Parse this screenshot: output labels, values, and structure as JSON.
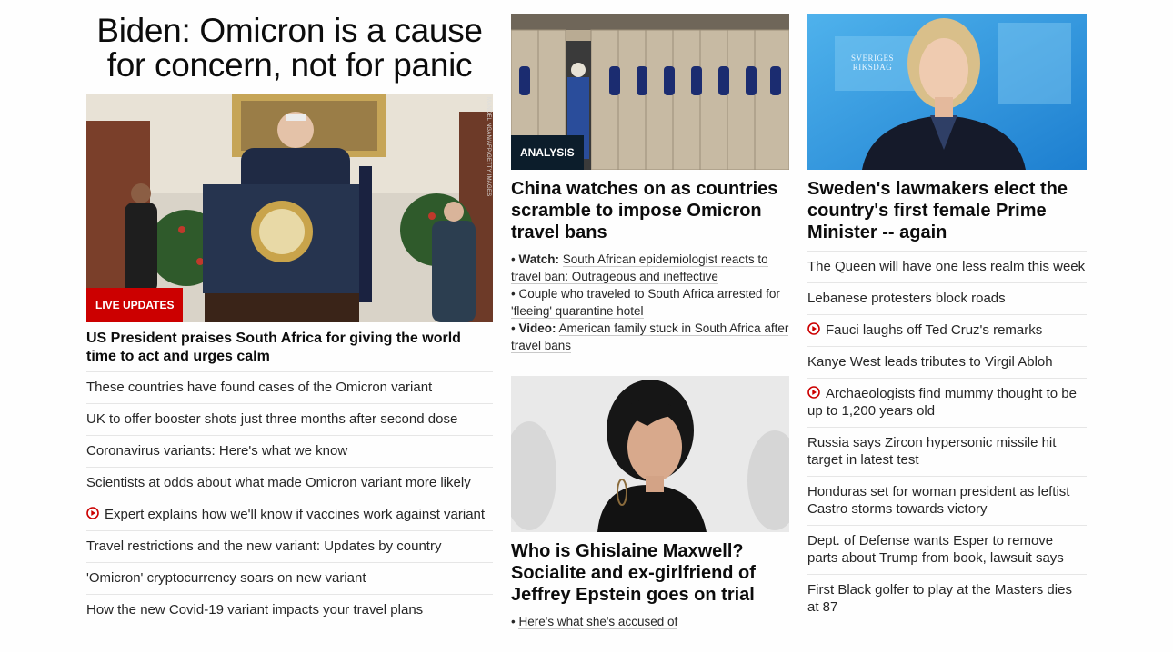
{
  "column1": {
    "headline": "Biden: Omicron is a cause for concern, not for panic",
    "image": {
      "badge": "LIVE UPDATES",
      "credit": "MANDEL NGAN/AFP/GETTY IMAGES"
    },
    "lead_title": "US President praises South Africa for giving the world time to act and urges calm",
    "items": [
      {
        "text": "These countries have found cases of the Omicron variant",
        "video": false
      },
      {
        "text": "UK to offer booster shots just three months after second dose",
        "video": false
      },
      {
        "text": "Coronavirus variants: Here's what we know",
        "video": false
      },
      {
        "text": "Scientists at odds about what made Omicron variant more likely",
        "video": false
      },
      {
        "text": "Expert explains how we'll know if vaccines work against variant",
        "video": true
      },
      {
        "text": "Travel restrictions and the new variant: Updates by country",
        "video": false
      },
      {
        "text": "'Omicron' cryptocurrency soars on new variant",
        "video": false
      },
      {
        "text": "How the new Covid-19 variant impacts your travel plans",
        "video": false
      }
    ]
  },
  "column2": {
    "story1": {
      "badge": "ANALYSIS",
      "title": "China watches on as countries scramble to impose Omicron travel bans",
      "subs": [
        {
          "prefix": "Watch:",
          "text": "South African epidemiologist reacts to travel ban: Outrageous and ineffective"
        },
        {
          "prefix": "",
          "text": "Couple who traveled to South Africa arrested for 'fleeing' quarantine hotel"
        },
        {
          "prefix": "Video:",
          "text": "American family stuck in South Africa after travel bans"
        }
      ]
    },
    "story2": {
      "title": "Who is Ghislaine Maxwell? Socialite and ex-girlfriend of Jeffrey Epstein goes on trial",
      "subs": [
        {
          "prefix": "",
          "text": "Here's what she's accused of"
        }
      ]
    }
  },
  "column3": {
    "image": {
      "sign_line1": "SVERIGES",
      "sign_line2": "RIKSDAG"
    },
    "title": "Sweden's lawmakers elect the country's first female Prime Minister -- again",
    "items": [
      {
        "text": "The Queen will have one less realm this week",
        "video": false
      },
      {
        "text": "Lebanese protesters block roads",
        "video": false
      },
      {
        "text": "Fauci laughs off Ted Cruz's remarks",
        "video": true
      },
      {
        "text": "Kanye West leads tributes to Virgil Abloh",
        "video": false
      },
      {
        "text": "Archaeologists find mummy thought to be up to 1,200 years old",
        "video": true
      },
      {
        "text": "Russia says Zircon hypersonic missile hit target in latest test",
        "video": false
      },
      {
        "text": "Honduras set for woman president as leftist Castro storms towards victory",
        "video": false
      },
      {
        "text": "Dept. of Defense wants Esper to remove parts about Trump from book, lawsuit says",
        "video": false
      },
      {
        "text": "First Black golfer to play at the Masters dies at 87",
        "video": false
      }
    ]
  },
  "colors": {
    "live_badge": "#cc0000",
    "analysis_badge": "#0c1d2b",
    "video_icon": "#cc0000"
  }
}
